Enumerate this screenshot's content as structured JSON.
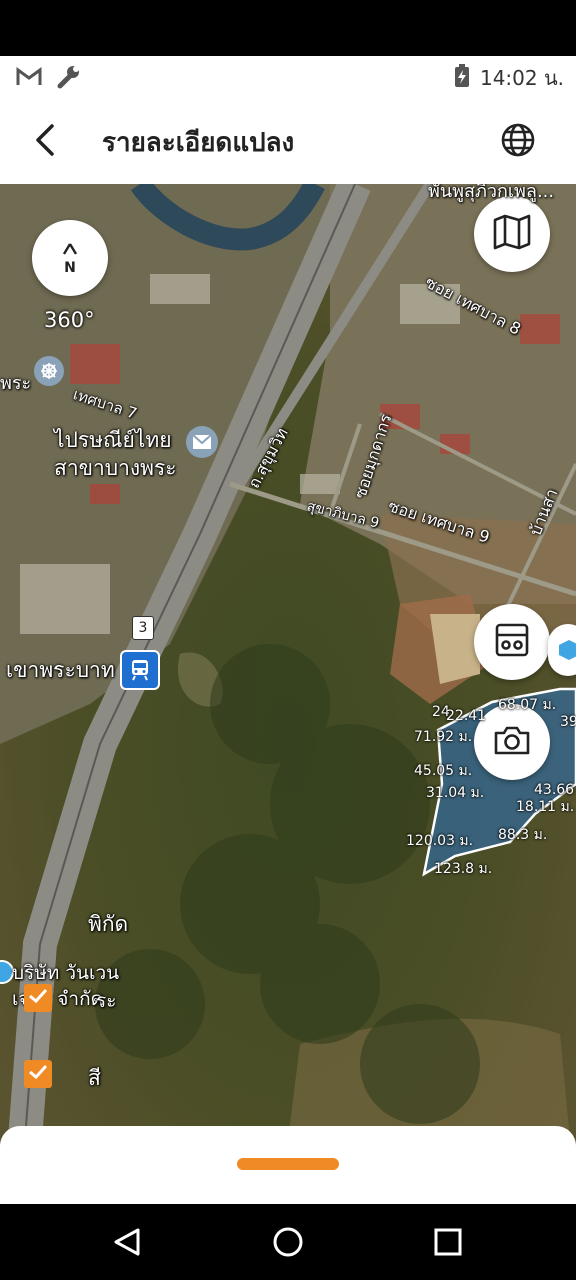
{
  "status": {
    "time": "14:02 น.",
    "icons": [
      "gmail-icon",
      "wrench-icon",
      "battery-charging-icon"
    ]
  },
  "header": {
    "title": "รายละเอียดแปลง",
    "back_icon": "arrow-left-icon",
    "globe_icon": "globe-icon"
  },
  "map": {
    "compass_label": "N",
    "rotation": "360°",
    "labels": {
      "post_office_line1": "ไปรษณีย์ไทย",
      "post_office_line2": "สาขาบางพระ",
      "station": "เขาพระบาท",
      "route_badge": "3",
      "road_sukhumvit": "ถ.สุขุมวิท",
      "soi_tessaban9": "ซอย เทศบาล 9",
      "soi_tessaban8": "ซอย เทศบาล 8",
      "soi_mukdakorn": "ซอยมุกดากร",
      "tessaban7": "เทศบาล 7",
      "sukhaphiban9": "สุขาภิบาล 9",
      "ban_sa": "บ้านสา",
      "phra_left": "พระ",
      "top_cut": "พันพูสุภิวกเพลู...",
      "pikad": "พิกัด",
      "company_line1": "บริษัท วันเวน",
      "company_line2": "เจอร์ จำกัด",
      "company_overlap": "ระ",
      "color_label": "สี"
    },
    "measurements": [
      "68.07 ม.",
      "24",
      "22.41",
      "71.92 ม.",
      "39",
      "45.05 ม.",
      "31.04 ม.",
      "43.66",
      "18.11 ม.",
      "120.03 ม.",
      "88.3 ม.",
      "123.8 ม."
    ],
    "colors": {
      "parcel_fill": "#2f6fb3",
      "accent": "#f08a24"
    }
  }
}
